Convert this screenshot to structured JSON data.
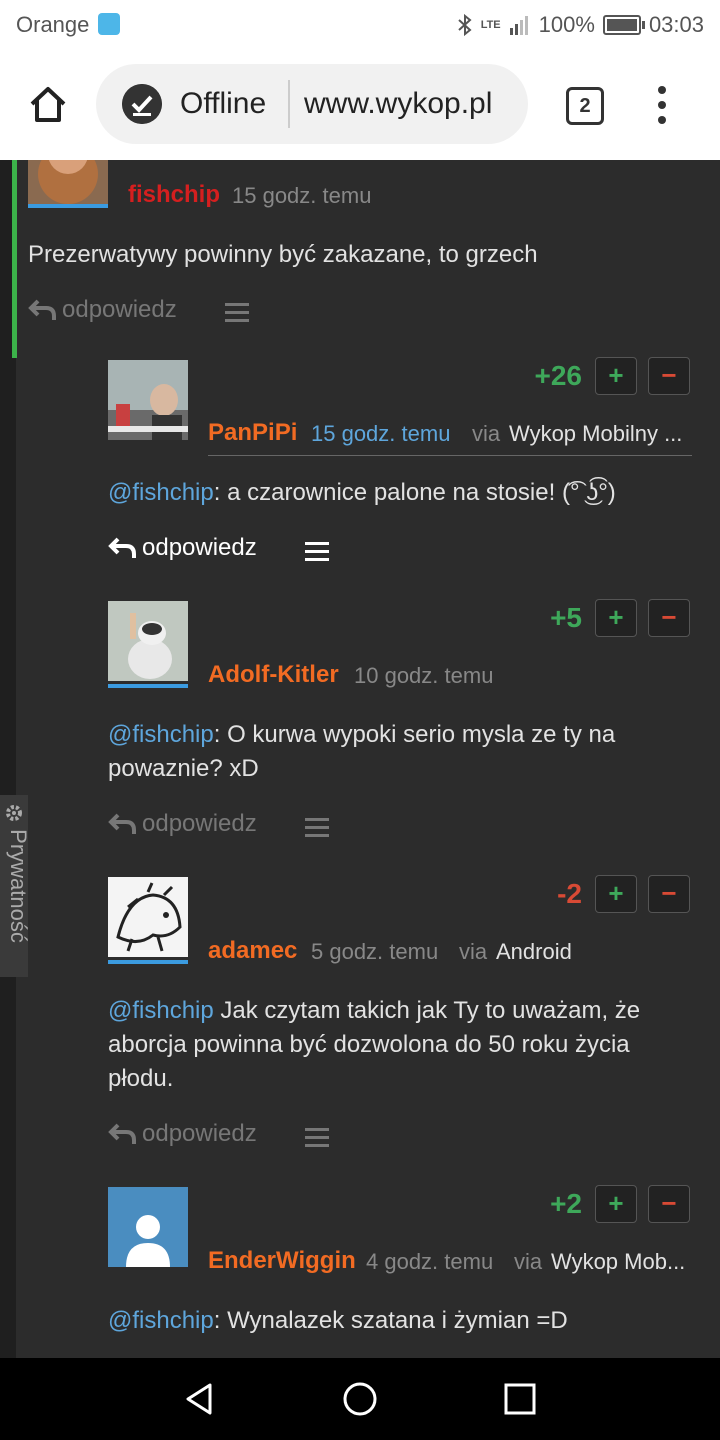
{
  "status_bar": {
    "carrier": "Orange",
    "network": "LTE",
    "battery": "100%",
    "time": "03:03"
  },
  "browser": {
    "offline_label": "Offline",
    "url": "www.wykop.pl",
    "tab_count": "2"
  },
  "privacy_tab": {
    "label": "Prywatność"
  },
  "comments": [
    {
      "author": "fishchip",
      "time": "15 godz. temu",
      "text": "Prezerwatywy powinny być zakazane, to grzech",
      "reply_label": "odpowiedz"
    },
    {
      "author": "PanPiPi",
      "time": "15 godz. temu",
      "via_label": "via",
      "via": "Wykop Mobilny ...",
      "score": "+26",
      "mention": "@fishchip",
      "text": ": a czarownice palone na stosie! (͡° ͜ʖ͡°)",
      "reply_label": "odpowiedz"
    },
    {
      "author": "Adolf-Kitler",
      "time": "10 godz. temu",
      "score": "+5",
      "mention": "@fishchip",
      "text": ": O kurwa wypoki serio mysla ze ty na powaznie? xD",
      "reply_label": "odpowiedz"
    },
    {
      "author": "adamec",
      "time": "5 godz. temu",
      "via_label": "via",
      "via": "Android",
      "score": "-2",
      "mention": "@fishchip",
      "text": " Jak czytam takich jak Ty to uważam, że aborcja powinna być dozwolona do 50 roku życia płodu.",
      "reply_label": "odpowiedz"
    },
    {
      "author": "EnderWiggin",
      "time": "4 godz. temu",
      "via_label": "via",
      "via": "Wykop Mob...",
      "score": "+2",
      "mention": "@fishchip",
      "text": ": Wynalazek szatana i żymian =D"
    }
  ],
  "vote": {
    "plus": "+",
    "minus": "−"
  },
  "colors": {
    "author": "#f26b23",
    "op_author": "#d51f1f",
    "mention": "#5ea6dc",
    "positive": "#3ea85a",
    "negative": "#d84a35",
    "thread_bar": "#3cb34a"
  }
}
